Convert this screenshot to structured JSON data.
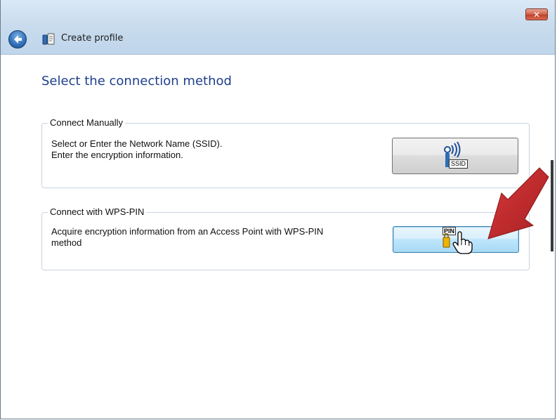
{
  "window": {
    "title": "Create profile",
    "close_label": "✕"
  },
  "page": {
    "heading": "Select the connection method"
  },
  "manual": {
    "legend": "Connect Manually",
    "line1": "Select or Enter the Network Name (SSID).",
    "line2": "Enter the encryption information.",
    "icon_label": "SSID"
  },
  "wps": {
    "legend": "Connect with WPS-PIN",
    "line1": "Acquire encryption information from an Access Point with WPS-PIN",
    "line2": "method",
    "icon_label": "PIN"
  },
  "colors": {
    "heading": "#1e3f8c",
    "arrow": "#c0262a"
  }
}
